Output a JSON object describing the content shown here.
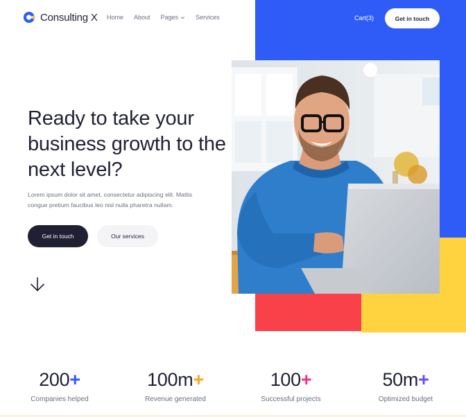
{
  "header": {
    "logo_text": "Consulting X",
    "nav": [
      {
        "label": "Home"
      },
      {
        "label": "About"
      },
      {
        "label": "Pages",
        "has_dropdown": true
      },
      {
        "label": "Services"
      }
    ],
    "cart_label": "Cart(3)",
    "cta_label": "Get in touch"
  },
  "hero": {
    "title": "Ready to take your business growth to the next level?",
    "description": "Lorem ipsum dolor sit amet, consectetur adipiscing elit. Mattis congue pretium faucibus leo nisl nulla pharetra nullam.",
    "primary_button": "Get in touch",
    "secondary_button": "Our services",
    "scroll_icon": "arrow-down-icon"
  },
  "stats": [
    {
      "value": "200",
      "suffix": "+",
      "suffix_color": "#2f5bf7",
      "label": "Companies helped"
    },
    {
      "value": "100m",
      "suffix": "+",
      "suffix_color": "#f6a623",
      "label": "Revenue generated"
    },
    {
      "value": "100",
      "suffix": "+",
      "suffix_color": "#f5317f",
      "label": "Successful projects"
    },
    {
      "value": "50m",
      "suffix": "+",
      "suffix_color": "#6c4cf5",
      "label": "Optimized budget"
    }
  ],
  "colors": {
    "brand_blue": "#2f5bf7",
    "accent_yellow": "#ffd23f",
    "accent_red": "#f94149",
    "dark": "#1f2033"
  }
}
